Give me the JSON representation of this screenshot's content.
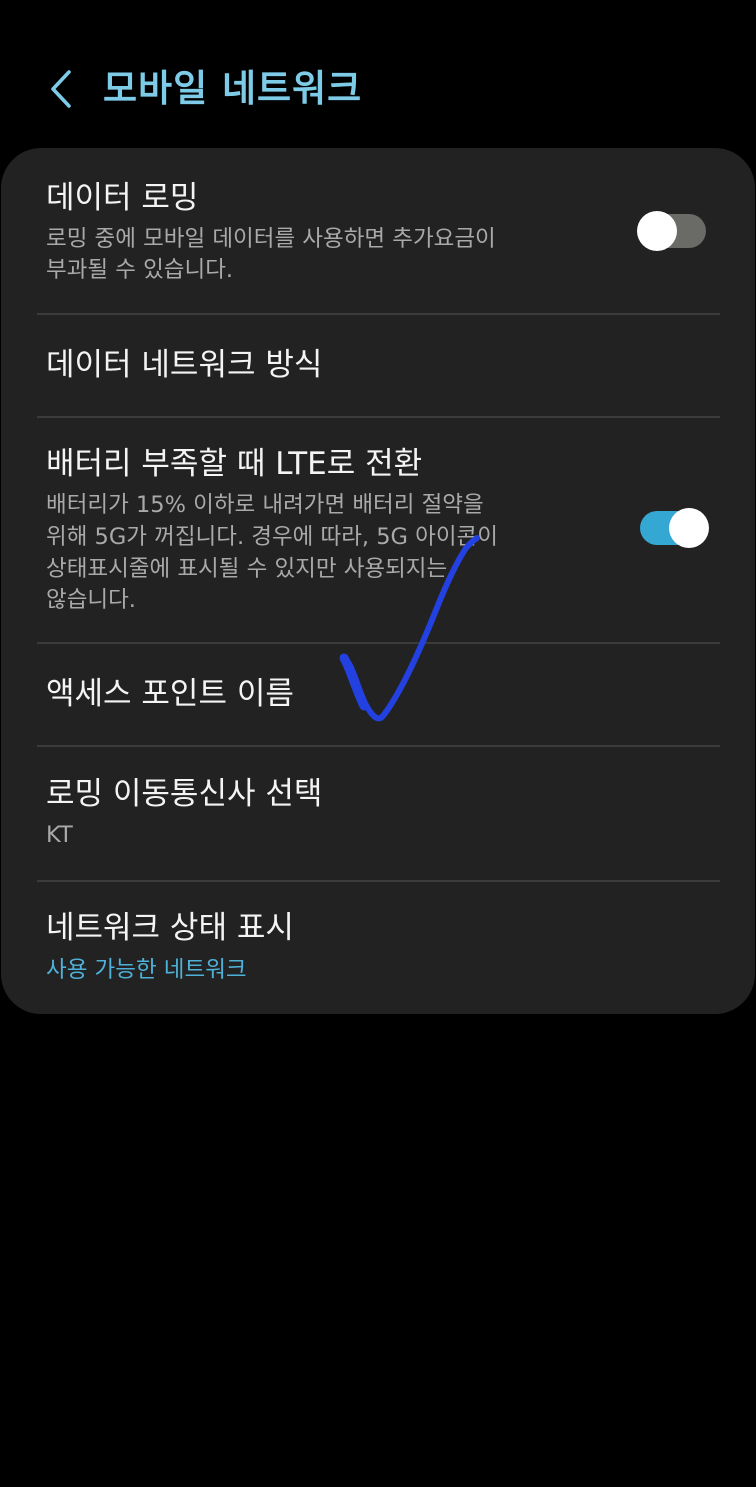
{
  "header": {
    "title": "모바일 네트워크"
  },
  "settings": {
    "items": [
      {
        "title": "데이터 로밍",
        "subtitle_lines": [
          "로밍 중에 모바일 데이터를 사용하면 추가요금이",
          "부과될 수 있습니다."
        ],
        "toggle_on": false
      },
      {
        "title": "데이터 네트워크 방식"
      },
      {
        "title": "배터리 부족할 때 LTE로 전환",
        "subtitle_lines": [
          "배터리가 15% 이하로 내려가면 배터리 절약을",
          "위해 5G가 꺼집니다. 경우에 따라, 5G 아이콘이",
          "상태표시줄에 표시될 수 있지만 사용되지는",
          "않습니다."
        ],
        "toggle_on": true
      },
      {
        "title": "액세스 포인트 이름"
      },
      {
        "title": "로밍 이동통신사 선택",
        "subtitle": "KT"
      },
      {
        "title": "네트워크 상태 표시",
        "subtitle": "사용 가능한 네트워크"
      }
    ]
  },
  "colors": {
    "background": "#000000",
    "card": "#222222",
    "title_accent": "#7ecbe8",
    "toggle_on_track": "#35a7d3",
    "toggle_off_track": "#6a6a66",
    "link_text": "#4fb1d8",
    "pen_mark": "#2341e0"
  },
  "icons": {
    "back": "chevron-left-icon"
  }
}
